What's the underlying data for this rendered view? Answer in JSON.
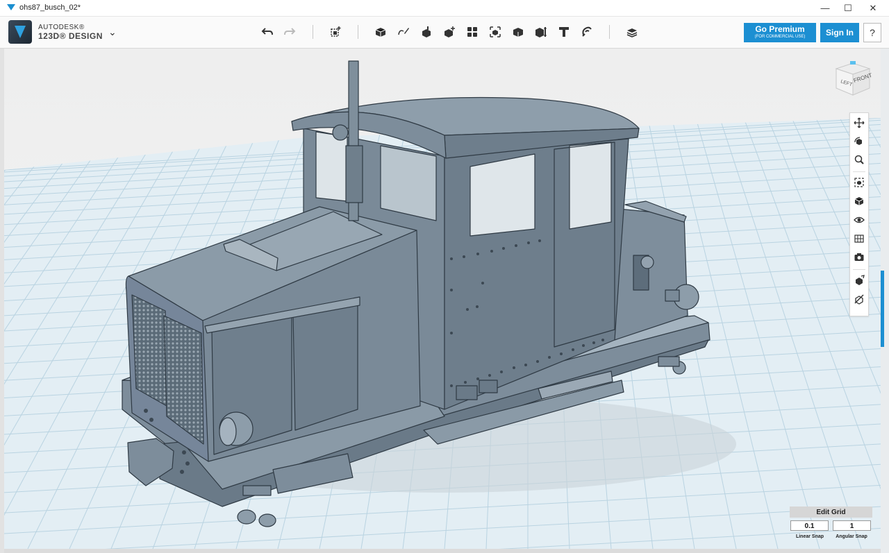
{
  "window": {
    "title": "ohs87_busch_02*",
    "minimize": "—",
    "maximize": "☐",
    "close": "✕"
  },
  "brand": {
    "line1": "AUTODESK®",
    "line2": "123D® DESIGN",
    "menu_chevron": "⌄"
  },
  "toolbar": {
    "tools": [
      "undo",
      "redo",
      "primitives",
      "sketch",
      "construct",
      "modify",
      "pattern",
      "grouping",
      "combine",
      "measure",
      "text",
      "snap",
      "material"
    ]
  },
  "account": {
    "premium_label": "Go Premium",
    "premium_sub": "(FOR COMMERCIAL USE)",
    "signin_label": "Sign In",
    "help_label": "?"
  },
  "viewcube": {
    "left_face": "LEFT",
    "front_face": "FRONT"
  },
  "navbar": {
    "items": [
      "pan",
      "orbit",
      "zoom",
      "fit",
      "views",
      "visibility",
      "materials-outline",
      "screenshot",
      "snap-tool",
      "model-toggle"
    ]
  },
  "grid": {
    "edit_label": "Edit Grid",
    "linear_value": "0.1",
    "angular_value": "1",
    "linear_label": "Linear Snap",
    "angular_label": "Angular Snap"
  },
  "colors": {
    "accent": "#1c8fd2",
    "model": "#6d7d8c",
    "grid_line": "#bcd6e3"
  }
}
